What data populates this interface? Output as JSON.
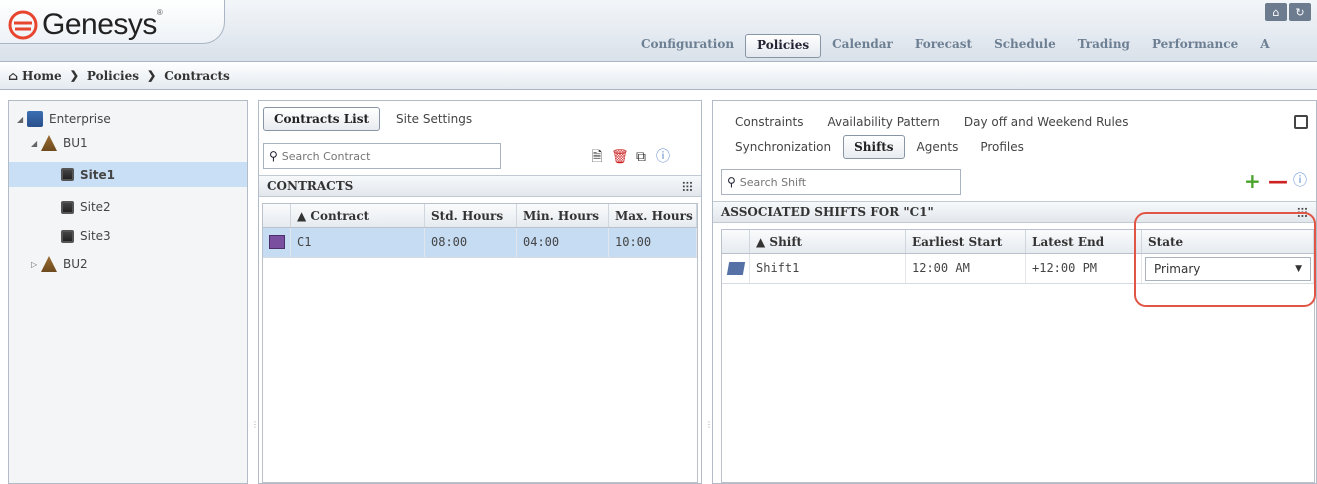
{
  "app": {
    "logo_text": "Genesys",
    "logo_reg": "®"
  },
  "top_icons": [
    "home-icon",
    "refresh-icon"
  ],
  "top_icon_glyphs": [
    "⌂",
    "↻"
  ],
  "main_nav": [
    "Configuration",
    "Policies",
    "Calendar",
    "Forecast",
    "Schedule",
    "Trading",
    "Performance",
    "A"
  ],
  "main_nav_active": "Policies",
  "breadcrumb": [
    "Home",
    "Policies",
    "Contracts"
  ],
  "tree": {
    "items": [
      {
        "label": "Enterprise",
        "icon": "enterprise-icon",
        "expanded": true
      },
      {
        "label": "BU1",
        "icon": "business-unit-icon",
        "expanded": true
      },
      {
        "label": "Site1",
        "icon": "site-icon",
        "selected": true
      },
      {
        "label": "Site2",
        "icon": "site-icon"
      },
      {
        "label": "Site3",
        "icon": "site-icon"
      },
      {
        "label": "BU2",
        "icon": "business-unit-icon",
        "expanded": false
      }
    ]
  },
  "contracts": {
    "tabs": [
      "Contracts List",
      "Site Settings"
    ],
    "active_tab": "Contracts List",
    "search_placeholder": "Search Contract",
    "section_title": "CONTRACTS",
    "columns": [
      "▲ Contract",
      "Std. Hours",
      "Min. Hours",
      "Max. Hours"
    ],
    "rows": [
      {
        "name": "C1",
        "std": "08:00",
        "min": "04:00",
        "max": "10:00",
        "selected": true
      }
    ]
  },
  "shifts": {
    "tabs_row1": [
      "Constraints",
      "Availability Pattern",
      "Day off and Weekend Rules"
    ],
    "tabs_row2": [
      "Synchronization",
      "Shifts",
      "Agents",
      "Profiles"
    ],
    "active_tab": "Shifts",
    "search_placeholder": "Search Shift",
    "section_title": "ASSOCIATED SHIFTS FOR \"C1\"",
    "columns": [
      "▲ Shift",
      "Earliest Start",
      "Latest End",
      "State"
    ],
    "rows": [
      {
        "name": "Shift1",
        "earliest": "12:00 AM",
        "latest": "+12:00 PM",
        "state": "Primary"
      }
    ]
  },
  "colors": {
    "highlight": "#e05545",
    "add": "#4aa32b",
    "remove": "#cc2222",
    "selected_row": "#c5dcf3"
  }
}
